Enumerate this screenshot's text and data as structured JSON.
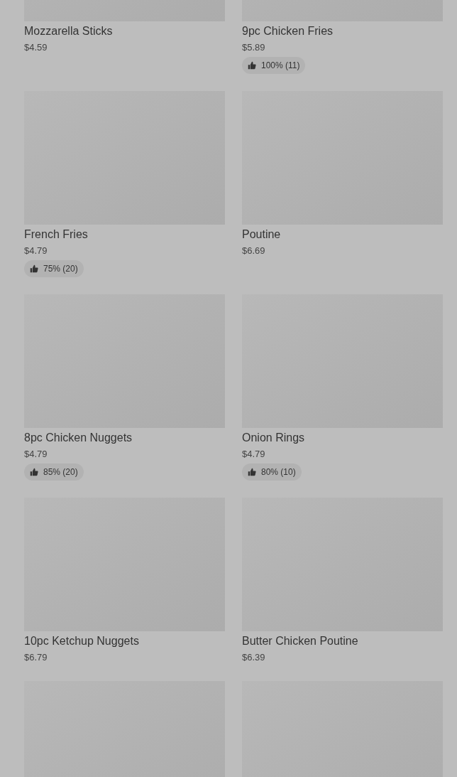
{
  "items": [
    {
      "kind": "product",
      "name": "Mozzarella Sticks",
      "price": "$4.59"
    },
    {
      "kind": "product",
      "name": "9pc Chicken Fries",
      "price": "$5.89",
      "rating": "100% (11)"
    },
    {
      "kind": "product",
      "name": "French Fries",
      "price": "$4.79",
      "rating": "75% (20)"
    },
    {
      "kind": "product",
      "name": "Poutine",
      "price": "$6.69"
    },
    {
      "kind": "product",
      "name": "8pc Chicken Nuggets",
      "price": "$4.79",
      "rating": "85% (20)"
    },
    {
      "kind": "product",
      "name": "Onion Rings",
      "price": "$4.79",
      "rating": "80% (10)"
    },
    {
      "kind": "product",
      "name": "10pc Ketchup Nuggets",
      "price": "$6.79"
    },
    {
      "kind": "product",
      "name": "Butter Chicken Poutine",
      "price": "$6.39"
    },
    {
      "kind": "image_only"
    },
    {
      "kind": "image_only"
    }
  ]
}
